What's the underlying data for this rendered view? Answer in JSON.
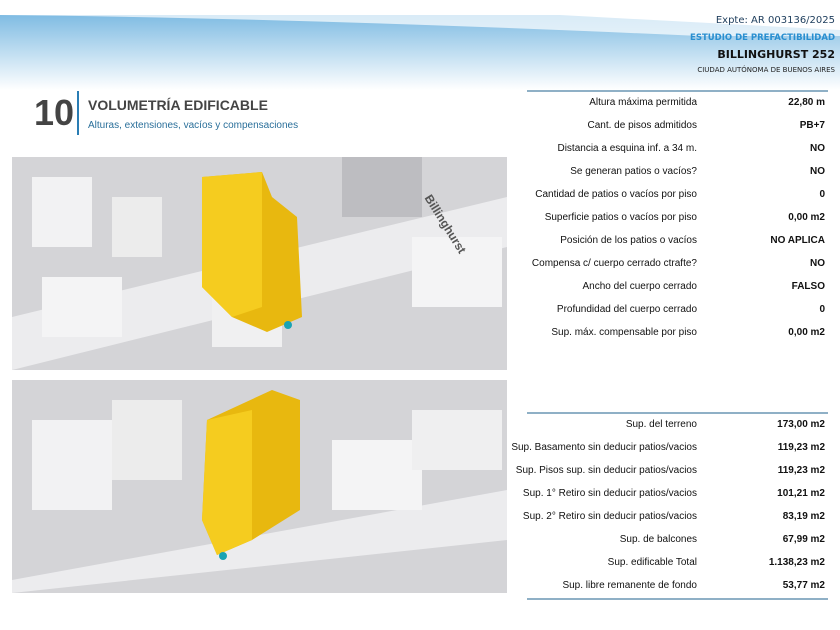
{
  "header": {
    "expte": "Expte: AR 003136/2025",
    "estudio": "ESTUDIO DE PREFACTIBILIDAD",
    "address": "BILLINGHURST 252",
    "city": "CIUDAD AUTÓNOMA DE BUENOS AIRES"
  },
  "section": {
    "number": "10",
    "title": "VOLUMETRÍA EDIFICABLE",
    "subtitle": "Alturas, extensiones, vacíos y compensaciones"
  },
  "images": {
    "street_label": "Billinghurst"
  },
  "table1": [
    {
      "label": "Altura máxima permitida",
      "value": "22,80 m"
    },
    {
      "label": "Cant. de pisos admitidos",
      "value": "PB+7"
    },
    {
      "label": "Distancia a esquina inf. a 34 m.",
      "value": "NO"
    },
    {
      "label": "Se generan patios o vacíos?",
      "value": "NO"
    },
    {
      "label": "Cantidad de patios o vacíos por piso",
      "value": "0"
    },
    {
      "label": "Superficie patios o vacíos por piso",
      "value": "0,00 m2"
    },
    {
      "label": "Posición de los patios o vacíos",
      "value": "NO APLICA"
    },
    {
      "label": "Compensa c/ cuerpo cerrado ctrafte?",
      "value": "NO"
    },
    {
      "label": "Ancho del  cuerpo cerrado",
      "value": "FALSO"
    },
    {
      "label": "Profundidad del  cuerpo cerrado",
      "value": "0"
    },
    {
      "label": "Sup. máx. compensable por piso",
      "value": "0,00 m2"
    }
  ],
  "table2": [
    {
      "label": "Sup. del terreno",
      "value": "173,00 m2"
    },
    {
      "label": "Sup. Basamento sin deducir patios/vacios",
      "value": "119,23 m2"
    },
    {
      "label": "Sup. Pisos sup. sin deducir patios/vacios",
      "value": "119,23 m2"
    },
    {
      "label": "Sup. 1° Retiro sin deducir patios/vacios",
      "value": "101,21 m2"
    },
    {
      "label": "Sup. 2° Retiro sin deducir patios/vacios",
      "value": "83,19 m2"
    },
    {
      "label": "Sup. de balcones",
      "value": "67,99 m2"
    },
    {
      "label": "Sup. edificable Total",
      "value": "1.138,23 m2"
    },
    {
      "label": "Sup. libre remanente de fondo",
      "value": "53,77 m2"
    }
  ]
}
